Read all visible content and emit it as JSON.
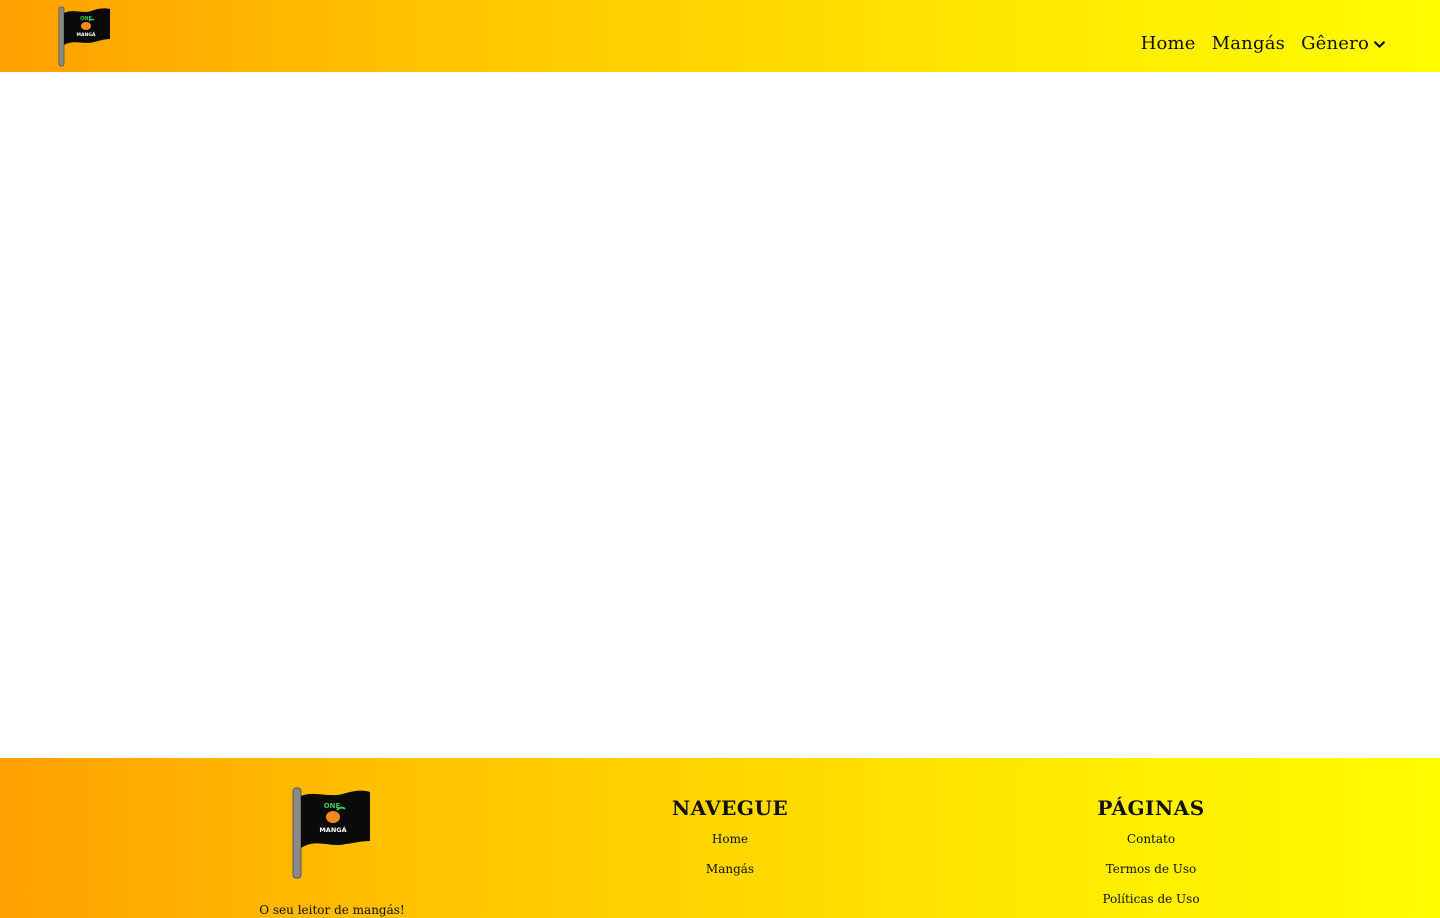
{
  "brand": {
    "logo_icon": "one-manga-flag-logo",
    "logo_text_top": "ONE",
    "logo_text_bottom": "MANGÁ",
    "tagline": "O seu leitor de mangás!"
  },
  "header": {
    "nav": [
      {
        "label": "Home"
      },
      {
        "label": "Mangás"
      },
      {
        "label": "Gênero",
        "icon": "chevron-down-icon"
      }
    ]
  },
  "footer": {
    "navegue": {
      "title": "NAVEGUE",
      "links": [
        {
          "label": "Home"
        },
        {
          "label": "Mangás"
        }
      ]
    },
    "paginas": {
      "title": "PÁGINAS",
      "links": [
        {
          "label": "Contato"
        },
        {
          "label": "Termos de Uso"
        },
        {
          "label": "Políticas de Uso"
        }
      ]
    }
  },
  "colors": {
    "gradient_start": "#ffa000",
    "gradient_end": "#fffc00",
    "text": "#111111",
    "logo_flag": "#0a0a0a",
    "logo_pole": "#8a8a8a",
    "logo_green": "#3ec94a",
    "logo_orange": "#f08a1c"
  }
}
